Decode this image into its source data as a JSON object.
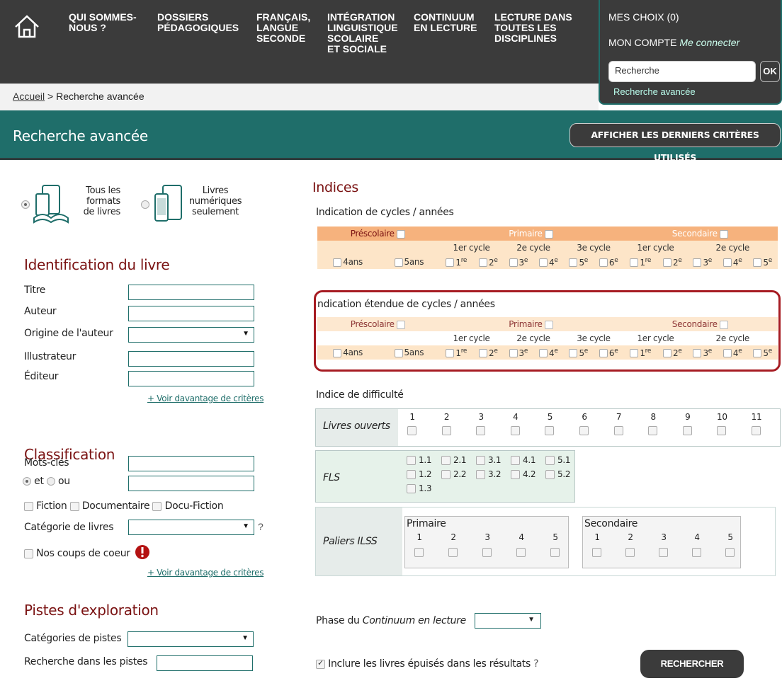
{
  "nav": {
    "items": [
      {
        "label": "QUI SOMMES-\nNOUS ?"
      },
      {
        "label": "DOSSIERS\nPÉDAGOGIQUES"
      },
      {
        "label": "FRANÇAIS,\nLANGUE\nSECONDE"
      },
      {
        "label": "INTÉGRATION\nLINGUISTIQUE\nSCOLAIRE\nET SOCIALE"
      },
      {
        "label": "CONTINUUM\nEN LECTURE"
      },
      {
        "label": "LECTURE DANS\nTOUTES LES\nDISCIPLINES"
      }
    ],
    "home_icon": "home-icon"
  },
  "account": {
    "choix": "MES CHOIX (0)",
    "compte": "MON COMPTE",
    "connect": "Me connecter",
    "search_value": "Recherche",
    "ok": "OK",
    "advanced": "Recherche avancée"
  },
  "breadcrumb": {
    "home": "Accueil",
    "sep": " > ",
    "current": "Recherche avancée"
  },
  "title": {
    "text": "Recherche avancée",
    "button": "AFFICHER LES DERNIERS CRITÈRES UTILISÉS"
  },
  "formats": {
    "all": "Tous les\nformats\nde livres",
    "digital": "Livres\nnumériques\nseulement"
  },
  "identification": {
    "heading": "Identification du livre",
    "titre": "Titre",
    "auteur": "Auteur",
    "origine": "Origine de l'auteur",
    "illustrateur": "Illustrateur",
    "editeur": "Éditeur",
    "more": "+ Voir davantage de critères"
  },
  "classification": {
    "heading": "Classification",
    "mots": "Mots-clés",
    "et": "et",
    "ou": "ou",
    "fiction": "Fiction",
    "documentaire": "Documentaire",
    "docufiction": "Docu-Fiction",
    "categorie": "Catégorie de livres",
    "q": "?",
    "coups": "Nos coups de coeur",
    "more": "+ Voir davantage de critères"
  },
  "pistes": {
    "heading": "Pistes d'exploration",
    "categories": "Catégories de pistes",
    "recherche": "Recherche dans les pistes"
  },
  "indices": {
    "heading": "Indices",
    "cycles_title": "Indication de cycles / années",
    "ext_title": "ndication étendue de cycles / années",
    "groups": [
      "Préscolaire",
      "Primaire",
      "Secondaire"
    ],
    "cycles": [
      "1er cycle",
      "2e cycle",
      "3e cycle",
      "1er cycle",
      "2e cycle"
    ],
    "years": [
      "4ans",
      "5ans",
      "1",
      "2",
      "3",
      "4",
      "5",
      "6",
      "1",
      "2",
      "3",
      "4",
      "5"
    ],
    "year_sup": [
      "",
      "",
      "re",
      "e",
      "e",
      "e",
      "e",
      "e",
      "re",
      "e",
      "e",
      "e",
      "e"
    ]
  },
  "difficulty": {
    "title": "Indice de difficulté",
    "ouverts": "Livres ouverts",
    "numbers": [
      "1",
      "2",
      "3",
      "4",
      "5",
      "6",
      "7",
      "8",
      "9",
      "10",
      "11"
    ],
    "fls": "FLS",
    "fls_items": [
      "1.1",
      "2.1",
      "3.1",
      "4.1",
      "5.1",
      "1.2",
      "2.2",
      "3.2",
      "4.2",
      "5.2",
      "1.3"
    ],
    "paliers": "Paliers ILSS",
    "primaire": "Primaire",
    "secondaire": "Secondaire",
    "palier_nums": [
      "1",
      "2",
      "3",
      "4",
      "5"
    ]
  },
  "phase": {
    "label_pre": "Phase du ",
    "label_em": "Continuum en lecture"
  },
  "include": {
    "label": "Inclure les livres épuisés dans les résultats",
    "q": "?"
  },
  "search_button": "RECHERCHER",
  "colors": {
    "teal": "#1f6e6a",
    "dark": "#3b3b3b",
    "maroon": "#7a1212",
    "orange": "#f6b27d",
    "peach": "#fde5c8",
    "red": "#a61b22"
  }
}
